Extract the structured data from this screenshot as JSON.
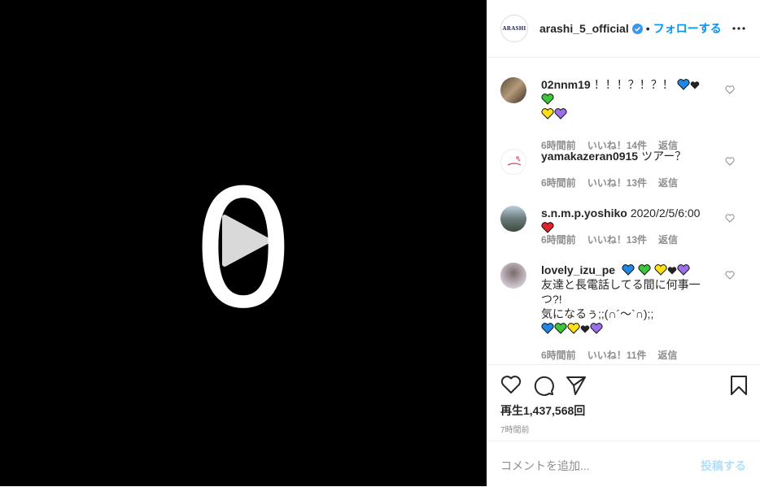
{
  "post": {
    "username": "arashi_5_official",
    "logo_text": "ARASHI",
    "follow_label": "フォローする",
    "separator": "•"
  },
  "video": {
    "overlay_text": "0"
  },
  "comments": [
    {
      "user": "02nnm19",
      "text": "！！！？！？！",
      "hearts": [
        "blue",
        "black",
        "green",
        "yellow",
        "purple"
      ],
      "time": "6時間前",
      "likes": "いいね！14件",
      "reply": "返信"
    },
    {
      "user": "yamakazeran0915",
      "text": "ツアー？",
      "hearts": [],
      "time": "6時間前",
      "likes": "いいね！13件",
      "reply": "返信"
    },
    {
      "user": "s.n.m.p.yoshiko",
      "text": "2020/2/5/6:00",
      "hearts": [
        "red"
      ],
      "time": "6時間前",
      "likes": "いいね！13件",
      "reply": "返信"
    },
    {
      "user": "lovely_izu_pe",
      "text_line1": "友達と長電話してる間に何事一",
      "text_line2": "つ?!",
      "text_line3": "気になるぅ;;(∩´〜`∩);;",
      "hearts_top": [
        "blue",
        "green",
        "yellow",
        "black",
        "purple"
      ],
      "hearts_bottom": [
        "blue",
        "green",
        "yellow",
        "black",
        "purple"
      ],
      "time": "6時間前",
      "likes": "いいね！11件",
      "reply": "返信"
    }
  ],
  "stats": {
    "views": "再生1,437,568回",
    "posted": "7時間前"
  },
  "add_comment": {
    "placeholder": "コメントを追加...",
    "post_label": "投稿する"
  },
  "colors": {
    "accent": "#0095f6",
    "muted": "#8e8e8e",
    "verified": "#3897f0"
  }
}
